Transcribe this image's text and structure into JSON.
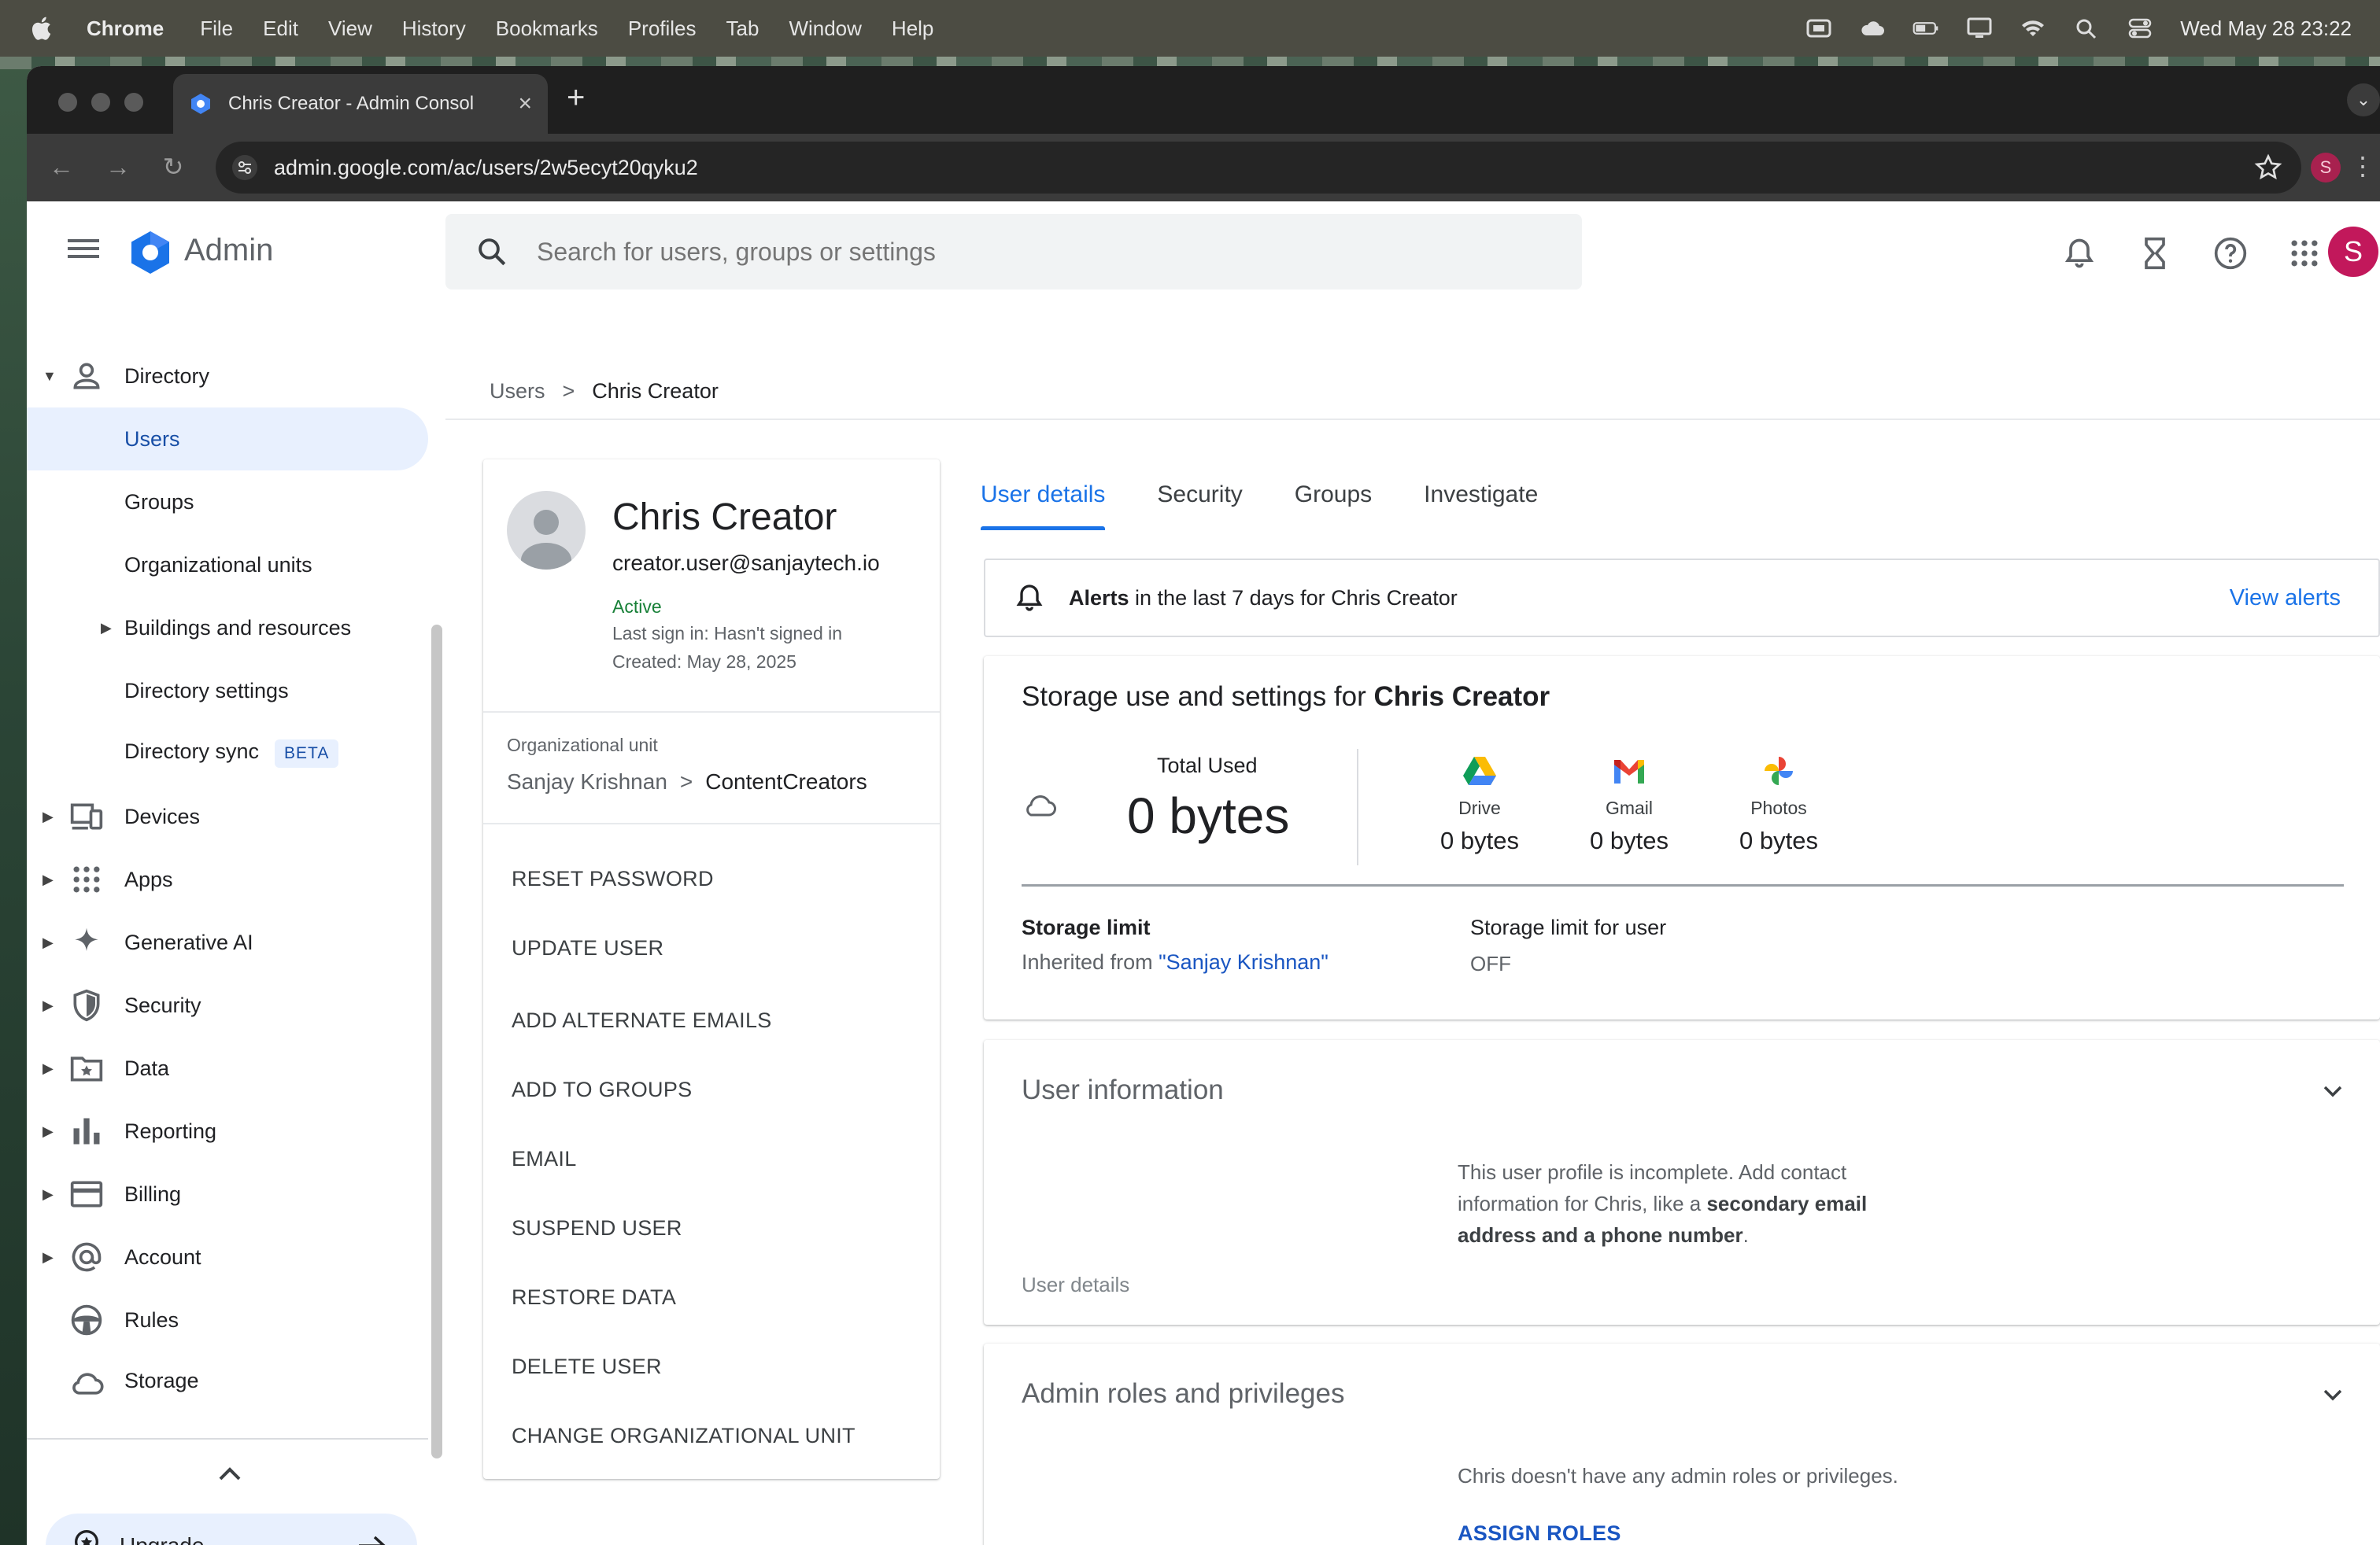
{
  "menubar": {
    "app": "Chrome",
    "items": [
      "File",
      "Edit",
      "View",
      "History",
      "Bookmarks",
      "Profiles",
      "Tab",
      "Window",
      "Help"
    ],
    "clock": "Wed May 28  23:22"
  },
  "browser": {
    "tab_title": "Chris Creator - Admin Consol",
    "url": "admin.google.com/ac/users/2w5ecyt20qyku2",
    "profile_initial": "S"
  },
  "header": {
    "brand": "Admin",
    "search_placeholder": "Search for users, groups or settings",
    "avatar_initial": "S"
  },
  "sidebar": {
    "items": [
      {
        "label": "Directory"
      },
      {
        "label": "Users"
      },
      {
        "label": "Groups"
      },
      {
        "label": "Organizational units"
      },
      {
        "label": "Buildings and resources"
      },
      {
        "label": "Directory settings"
      },
      {
        "label": "Directory sync",
        "badge": "BETA"
      },
      {
        "label": "Devices"
      },
      {
        "label": "Apps"
      },
      {
        "label": "Generative AI"
      },
      {
        "label": "Security"
      },
      {
        "label": "Data"
      },
      {
        "label": "Reporting"
      },
      {
        "label": "Billing"
      },
      {
        "label": "Account"
      },
      {
        "label": "Rules"
      },
      {
        "label": "Storage"
      }
    ],
    "upgrade": "Upgrade"
  },
  "breadcrumb": {
    "parent": "Users",
    "separator": ">",
    "current": "Chris Creator"
  },
  "user": {
    "name": "Chris Creator",
    "email": "creator.user@sanjaytech.io",
    "status": "Active",
    "last_sign_in": "Last sign in: Hasn't signed in",
    "created": "Created: May 28, 2025",
    "ou_label": "Organizational unit",
    "ou_parent": "Sanjay Krishnan",
    "ou_sep": ">",
    "ou_leaf": "ContentCreators"
  },
  "actions": [
    "RESET PASSWORD",
    "UPDATE USER",
    "ADD ALTERNATE EMAILS",
    "ADD TO GROUPS",
    "EMAIL",
    "SUSPEND USER",
    "RESTORE DATA",
    "DELETE USER",
    "CHANGE ORGANIZATIONAL UNIT"
  ],
  "tabs": [
    "User details",
    "Security",
    "Groups",
    "Investigate"
  ],
  "alerts": {
    "bold": "Alerts",
    "text": " in the last 7 days for Chris Creator",
    "link": "View alerts"
  },
  "storage": {
    "title_prefix": "Storage use and settings for ",
    "title_name": "Chris Creator",
    "total_label": "Total Used",
    "total_value": "0 bytes",
    "services": [
      {
        "name": "Drive",
        "value": "0 bytes"
      },
      {
        "name": "Gmail",
        "value": "0 bytes"
      },
      {
        "name": "Photos",
        "value": "0 bytes"
      }
    ],
    "limit_label": "Storage limit",
    "inherited_prefix": "Inherited from ",
    "inherited_link": "\"Sanjay Krishnan\"",
    "user_limit_label": "Storage limit for user",
    "user_limit_value": "OFF"
  },
  "user_information": {
    "title": "User information",
    "body_prefix": "This user profile is incomplete. Add contact information for Chris, like a ",
    "body_bold": "secondary email address and a phone number",
    "body_suffix": ".",
    "footer": "User details"
  },
  "admin_roles": {
    "title": "Admin roles and privileges",
    "body": "Chris doesn't have any admin roles or privileges.",
    "assign": "ASSIGN ROLES"
  },
  "colors": {
    "accent": "#1a73e8",
    "active_bg": "#e8f0fe",
    "status_green": "#188038",
    "avatar": "#c2185b"
  }
}
